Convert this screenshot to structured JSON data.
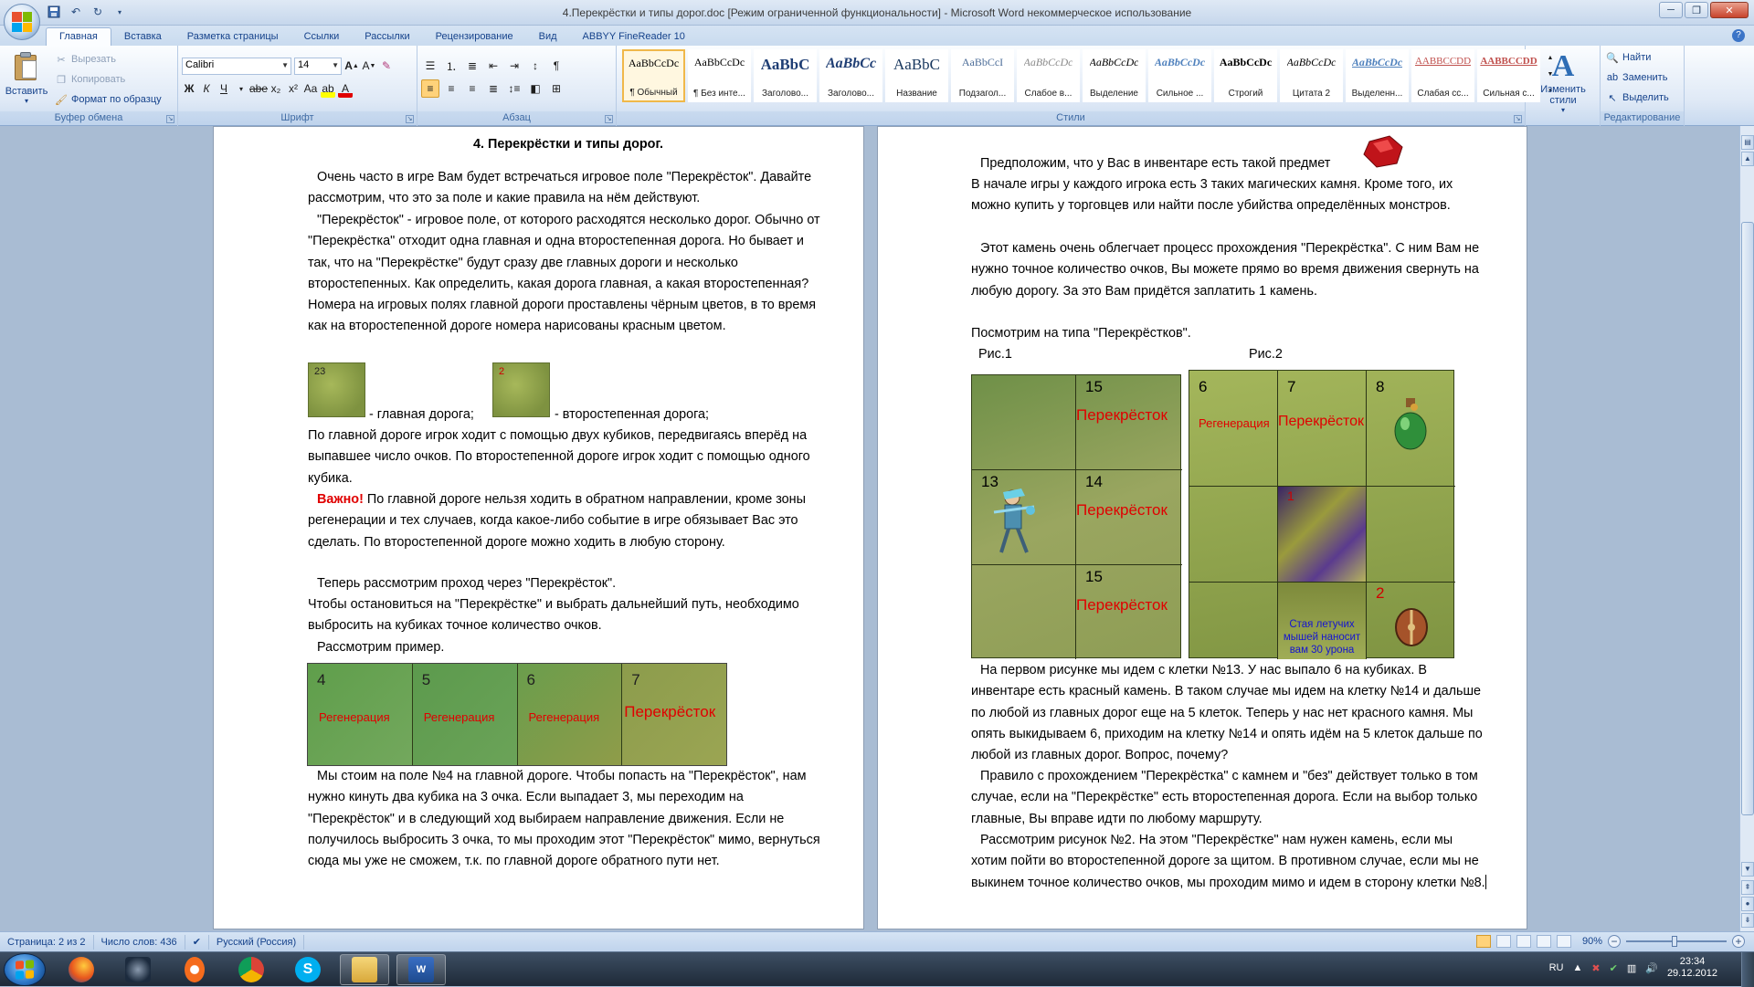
{
  "window": {
    "title": "4.Перекрёстки и типы дорог.doc [Режим ограниченной функциональности] - Microsoft Word некоммерческое использование",
    "controls": {
      "minimize": "─",
      "maximize": "❐",
      "close": "✕"
    }
  },
  "quick_access": {
    "save_icon": "save-icon",
    "undo_icon": "undo-icon",
    "redo_icon": "redo-icon"
  },
  "tabs": [
    "Главная",
    "Вставка",
    "Разметка страницы",
    "Ссылки",
    "Рассылки",
    "Рецензирование",
    "Вид",
    "ABBYY FineReader 10"
  ],
  "active_tab": "Главная",
  "ribbon": {
    "clipboard": {
      "label": "Буфер обмена",
      "paste": "Вставить",
      "cut": "Вырезать",
      "copy": "Копировать",
      "format_painter": "Формат по образцу"
    },
    "font": {
      "label": "Шрифт",
      "font_name": "Calibri",
      "font_size": "14"
    },
    "paragraph": {
      "label": "Абзац"
    },
    "styles": {
      "label": "Стили",
      "tiles": [
        {
          "sample": "AaBbCcDc",
          "name": "¶ Обычный"
        },
        {
          "sample": "AaBbCcDc",
          "name": "¶ Без инте..."
        },
        {
          "sample": "AaBbC",
          "name": "Заголово..."
        },
        {
          "sample": "AaBbCc",
          "name": "Заголово..."
        },
        {
          "sample": "AaBbC",
          "name": "Название"
        },
        {
          "sample": "AaBbCcI",
          "name": "Подзагол..."
        },
        {
          "sample": "AaBbCcDc",
          "name": "Слабое в..."
        },
        {
          "sample": "AaBbCcDc",
          "name": "Выделение"
        },
        {
          "sample": "AaBbCcDc",
          "name": "Сильное ..."
        },
        {
          "sample": "AaBbCcDc",
          "name": "Строгий"
        },
        {
          "sample": "AaBbCcDc",
          "name": "Цитата 2"
        },
        {
          "sample": "AaBbCcDc",
          "name": "Выделенн..."
        },
        {
          "sample": "AABBCCDD",
          "name": "Слабая сс..."
        },
        {
          "sample": "AABBCCDD",
          "name": "Сильная с..."
        }
      ],
      "change_styles": "Изменить стили"
    },
    "editing": {
      "label": "Редактирование",
      "find": "Найти",
      "replace": "Заменить",
      "select": "Выделить"
    }
  },
  "page1": {
    "heading": "4. Перекрёстки и типы дорог.",
    "p1": "Очень часто в игре Вам будет встречаться игровое поле \"Перекрёсток\". Давайте рассмотрим, что это за поле и какие правила на нём действуют.",
    "p2": "\"Перекрёсток\" - игровое поле, от которого расходятся несколько дорог. Обычно от \"Перекрёстка\" отходит одна главная и одна второстепенная дорога. Но бывает и так, что на \"Перекрёстке\" будут сразу две главных дороги и несколько второстепенных. Как определить, какая дорога главная, а какая второстепенная? Номера на игровых полях главной дороги проставлены чёрным цветов, в то время как на второстепенной дороге номера нарисованы красным цветом.",
    "tile_main_num": "23",
    "tile_main_caption": "- главная дорога;",
    "tile_secondary_num": "2",
    "tile_secondary_caption": "- второстепенная дорога;",
    "p3": "По главной дороге игрок ходит с помощью двух кубиков, передвигаясь вперёд на выпавшее число очков. По второстепенной дороге игрок ходит с помощью одного кубика.",
    "important_label": "Важно!",
    "p4": " По главной дороге нельзя ходить в обратном направлении, кроме зоны регенерации и тех случаев, когда какое-либо событие в игре обязывает Вас это сделать. По второстепенной дороге можно ходить в любую сторону.",
    "p5": "Теперь рассмотрим проход через \"Перекрёсток\".",
    "p6": "Чтобы остановиться на \"Перекрёстке\" и выбрать дальнейший путь, необходимо выбросить на кубиках точное количество очков.",
    "p7": "Рассмотрим пример.",
    "strip": [
      {
        "num": "4",
        "label": "Регенерация"
      },
      {
        "num": "5",
        "label": "Регенерация"
      },
      {
        "num": "6",
        "label": "Регенерация"
      },
      {
        "num": "7",
        "label": "Перекрёсток"
      }
    ],
    "p8": "Мы стоим на поле №4 на главной дороге. Чтобы попасть на \"Перекрёсток\", нам нужно кинуть два кубика на 3 очка. Если выпадает 3, мы переходим на \"Перекрёсток\" и в следующий ход выбираем направление движения. Если не получилось выбросить 3 очка, то мы проходим этот \"Перекрёсток\" мимо, вернуться сюда мы уже не сможем, т.к. по главной дороге обратного пути нет."
  },
  "page2": {
    "p1": "Предположим, что у Вас в инвентаре есть такой предмет",
    "p2": "В начале игры у каждого игрока есть 3 таких магических камня. Кроме того, их можно купить у торговцев или найти после убийства определённых монстров.",
    "p3": "Этот камень очень облегчает процесс прохождения \"Перекрёстка\". С ним Вам не нужно точное количество очков, Вы можете прямо во время движения свернуть на любую дорогу. За это Вам придётся заплатить 1 камень.",
    "p4": "Посмотрим на типа \"Перекрёстков\".",
    "fig1_caption": "Рис.1",
    "fig2_caption": "Рис.2",
    "fig1": [
      {
        "num": "",
        "label": ""
      },
      {
        "num": "15",
        "label": "Перекрёсток"
      },
      {
        "num": "13",
        "label": ""
      },
      {
        "num": "14",
        "label": "Перекрёсток"
      },
      {
        "num": "",
        "label": ""
      },
      {
        "num": "15",
        "label": "Перекрёсток"
      }
    ],
    "fig2": {
      "c1_num": "6",
      "c1_label": "Регенерация",
      "c2_num": "7",
      "c2_label": "Перекрёсток",
      "c3_num": "8",
      "bat_num": "1",
      "bat_text": "Стая летучих мышей наносит вам 30 урона",
      "c6_num": "2"
    },
    "p5": "На первом рисунке мы идем с клетки №13. У нас выпало 6 на кубиках. В инвентаре есть красный камень. В таком случае мы идем на клетку №14 и дальше по любой из главных дорог еще на 5 клеток. Теперь у нас нет красного камня. Мы опять выкидываем 6, приходим на клетку №14 и опять идём на 5 клеток дальше по любой из главных дорог. Вопрос, почему?",
    "p6": "Правило с прохождением \"Перекрёстка\" с камнем и \"без\" действует только в том случае, если на \"Перекрёстке\" есть второстепенная дорога. Если на выбор только главные, Вы вправе идти по любому маршруту.",
    "p7": "Рассмотрим рисунок №2. На этом \"Перекрёстке\" нам нужен камень, если мы хотим пойти во второстепенной дороге за щитом. В противном случае, если мы не выкинем точное количество очков, мы проходим мимо и идем в сторону клетки №8."
  },
  "status": {
    "page": "Страница: 2 из 2",
    "words": "Число слов: 436",
    "language": "Русский (Россия)",
    "zoom": "90%"
  },
  "taskbar": {
    "lang": "RU",
    "time": "23:34",
    "date": "29.12.2012"
  },
  "colors": {
    "accent": "#15428b",
    "red_text": "#e00000",
    "page_bg": "#a9bcd3"
  }
}
